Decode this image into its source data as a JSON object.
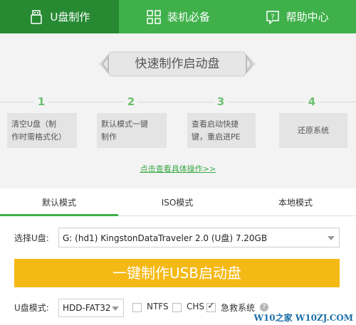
{
  "topnav": {
    "tabs": [
      {
        "label": "U盘制作",
        "icon": "usb-drive-icon"
      },
      {
        "label": "装机必备",
        "icon": "apps-grid-icon"
      },
      {
        "label": "帮助中心",
        "icon": "help-icon"
      }
    ],
    "active_index": 0
  },
  "intro": {
    "banner": "快速制作启动盘",
    "steps": [
      {
        "number": "1",
        "line1": "清空U盘（制",
        "line2": "作时需格式化）"
      },
      {
        "number": "2",
        "line1": "默认模式一键",
        "line2": "制作"
      },
      {
        "number": "3",
        "line1": "查看启动快捷",
        "line2": "键，重启进PE"
      },
      {
        "number": "4",
        "line1": "还原系统",
        "line2": ""
      }
    ],
    "detail_link": "点击查看具体操作>>"
  },
  "mode_tabs": {
    "items": [
      "默认模式",
      "ISO模式",
      "本地模式"
    ],
    "active_index": 0
  },
  "device": {
    "label": "选择U盘:",
    "value": "G: (hd1) KingstonDataTraveler 2.0 (U盘) 7.20GB"
  },
  "make_button": "一键制作USB启动盘",
  "options": {
    "mode_label": "U盘模式:",
    "mode_value": "HDD-FAT32",
    "ntfs": {
      "label": "NTFS",
      "checked": false
    },
    "chs": {
      "label": "CHS",
      "checked": false
    },
    "rescue": {
      "label": "急救系统",
      "checked": true
    }
  },
  "watermark": "W10之家 W10ZJ.COM",
  "colors": {
    "green": "#3fb04a",
    "green_dark": "#278a33",
    "yellow": "#f5b915"
  }
}
